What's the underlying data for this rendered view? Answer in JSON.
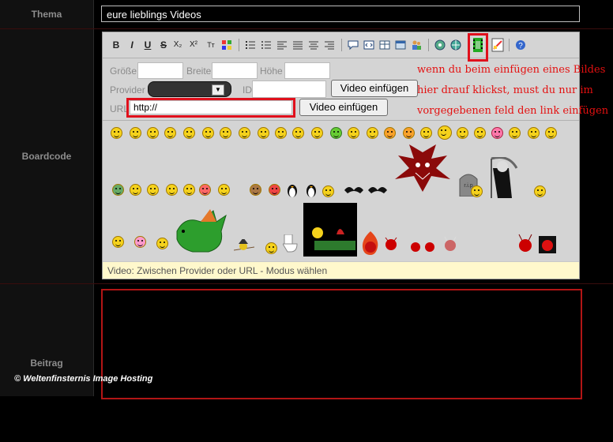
{
  "labels": {
    "thema": "Thema",
    "boardcode": "Boardcode",
    "beitrag": "Beitrag"
  },
  "thema_value": "eure lieblings Videos",
  "toolbar": {
    "bold": "B",
    "italic": "I",
    "underline": "U",
    "strike": "S",
    "subscript": "X₂",
    "superscript": "X²",
    "fontsize": "Tт"
  },
  "video_form": {
    "groesse_label": "Größe",
    "breite_label": "Breite",
    "hoehe_label": "Höhe",
    "provider_label": "Provider",
    "id_label": "ID",
    "url_label": "URL",
    "url_value": "http://",
    "insert_button_1": "Video einfügen",
    "insert_button_2": "Video einfügen"
  },
  "status_text": "Video: Zwischen Provider oder URL - Modus wählen",
  "annotation": {
    "line1": "wenn du beim einfügen eines Bildes",
    "line2": "hier drauf klickst, must du nur im",
    "line3": "vorgegebenen feld den link einfügen"
  },
  "copyright": "© Weltenfinsternis Image Hosting",
  "colors": {
    "highlight": "#e0101c",
    "annotation_text": "#e41010",
    "status_bg": "#fff8cc"
  }
}
